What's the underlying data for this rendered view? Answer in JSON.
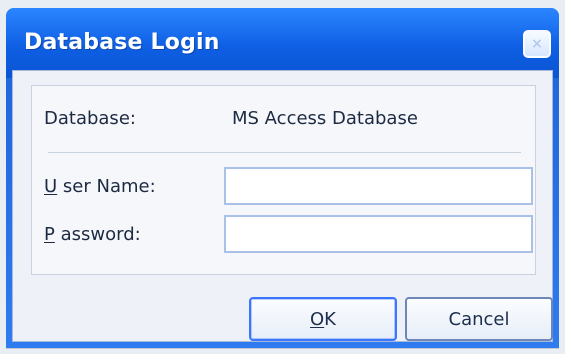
{
  "window": {
    "title": "Database Login",
    "close_label": "×"
  },
  "form": {
    "database_label": "Database:",
    "database_value": "MS Access Database",
    "user_name_label_prefix": "",
    "user_name_label_mnemonic": "U",
    "user_name_label_rest": "ser Name:",
    "password_label_prefix": "",
    "password_label_mnemonic": "P",
    "password_label_rest": "assword:",
    "user_name_value": "",
    "password_value": "",
    "user_name_placeholder": "",
    "password_placeholder": ""
  },
  "buttons": {
    "ok_mnemonic": "O",
    "ok_rest": "K",
    "cancel_label": "Cancel"
  },
  "colors": {
    "titlebar_start": "#2b86ff",
    "titlebar_end": "#0a55d3",
    "focused_button_border": "#3b76ff"
  }
}
